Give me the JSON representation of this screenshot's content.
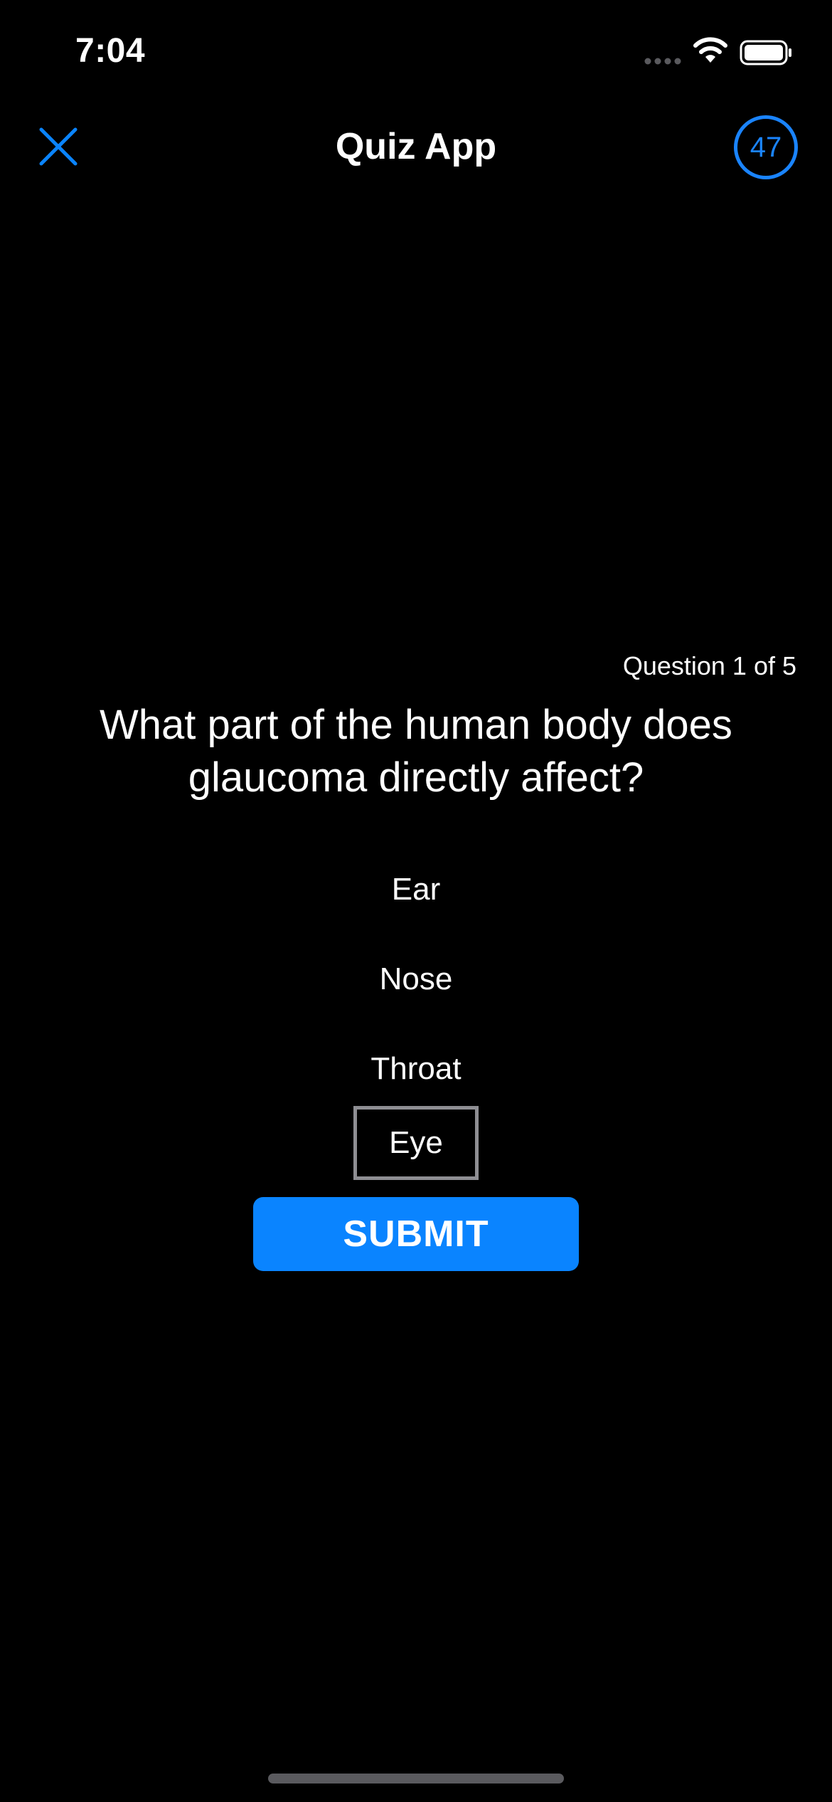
{
  "status_bar": {
    "time": "7:04"
  },
  "nav": {
    "title": "Quiz App",
    "timer": "47",
    "close_icon": "close-icon"
  },
  "quiz": {
    "counter": "Question 1 of 5",
    "question": "What part of the human body does glaucoma directly affect?",
    "answers": [
      {
        "label": "Ear",
        "selected": false
      },
      {
        "label": "Nose",
        "selected": false
      },
      {
        "label": "Throat",
        "selected": false
      },
      {
        "label": "Eye",
        "selected": true
      }
    ],
    "submit_label": "SUBMIT"
  },
  "colors": {
    "accent": "#0a84ff",
    "background": "#000000",
    "selected_border": "#8e8e93"
  }
}
